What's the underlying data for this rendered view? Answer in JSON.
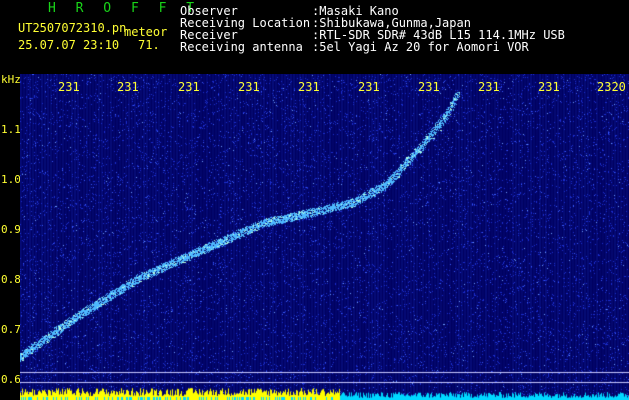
{
  "header": {
    "app_title": "H R O F F T",
    "file_name": "UT2507072310.pn",
    "event_type": "meteor",
    "datetime": "25.07.07 23:10",
    "value": "71.",
    "labels": {
      "observer": "Observer",
      "location": "Receiving Location",
      "receiver": "Receiver",
      "antenna": "Receiving antenna"
    },
    "values": {
      "observer": ":Masaki Kano",
      "location": ":Shibukawa,Gunma,Japan",
      "receiver": ":RTL-SDR SDR# 43dB L15 114.1MHz USB",
      "antenna": ":5el Yagi Az 20 for Aomori VOR"
    }
  },
  "spectrogram": {
    "y_unit": "kHz",
    "y_ticks": [
      "1.1",
      "1.0",
      "0.9",
      "0.8",
      "0.7",
      "0.6"
    ],
    "y_range": [
      0.6,
      1.15
    ],
    "x_ticks": [
      "231",
      "231",
      "231",
      "231",
      "231",
      "231",
      "231",
      "231",
      "231",
      "2320"
    ],
    "colors": {
      "background": "#000060",
      "noise": "#1e3cff",
      "trail": "#4db8ff",
      "trail_core": "#b6ffe0",
      "text": "#ffff33",
      "baseline_yellow": "#ffff00",
      "baseline_cyan": "#00d8ff"
    },
    "trail_points_khz": [
      [
        0.0,
        0.64
      ],
      [
        0.1,
        0.72
      ],
      [
        0.2,
        0.79
      ],
      [
        0.3,
        0.84
      ],
      [
        0.4,
        0.89
      ],
      [
        0.5,
        0.915
      ],
      [
        0.55,
        0.93
      ],
      [
        0.6,
        0.96
      ],
      [
        0.65,
        1.02
      ],
      [
        0.7,
        1.09
      ],
      [
        0.72,
        1.13
      ]
    ]
  }
}
